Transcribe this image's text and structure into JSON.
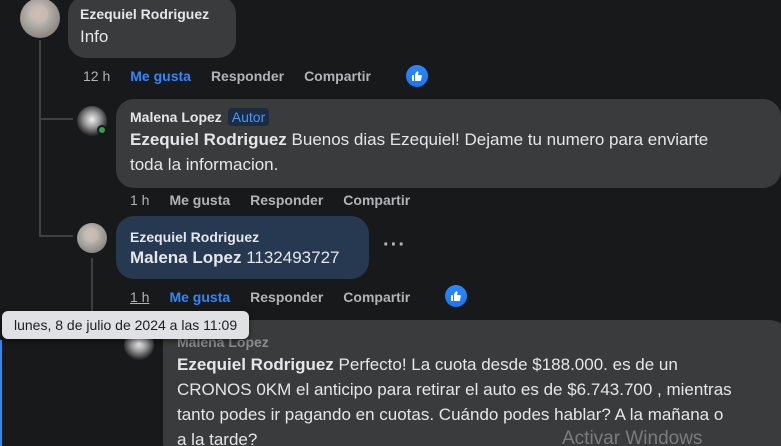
{
  "comment1": {
    "author": "Ezequiel Rodriguez",
    "text": "Info",
    "time": "12 h",
    "like_label": "Me gusta",
    "reply_label": "Responder",
    "share_label": "Compartir"
  },
  "reply1": {
    "author": "Malena Lopez",
    "badge": "Autor",
    "mention": "Ezequiel Rodriguez",
    "text_line1": " Buenos dias Ezequiel! Dejame tu numero para enviarte",
    "text_line2": "toda la informacion.",
    "time": "1 h",
    "like_label": "Me gusta",
    "reply_label": "Responder",
    "share_label": "Compartir"
  },
  "reply2": {
    "author": "Ezequiel Rodriguez",
    "mention": "Malena Lopez",
    "text": " 1132493727",
    "more_label": "···",
    "time": "1 h",
    "like_label": "Me gusta",
    "reply_label": "Responder",
    "share_label": "Compartir"
  },
  "reply3": {
    "author": "Malena Lopez",
    "mention": "Ezequiel Rodriguez",
    "text_line1": " Perfecto! La cuota desde $188.000. es de un",
    "text_line2": "CRONOS 0KM el anticipo para retirar el auto es de $6.743.700 , mientras",
    "text_line3": "tanto podes ir pagando en cuotas. Cuándo podes hablar? A la mañana o",
    "text_line4": "a la tarde?"
  },
  "tooltip": {
    "text": "lunes, 8 de julio de 2024 a las 11:09"
  },
  "watermark": {
    "text": "Activar Windows"
  },
  "colors": {
    "background": "#18191a",
    "bubble": "#3a3b3c",
    "highlight_bubble": "#263951",
    "link_blue": "#2d88ff",
    "muted": "#b0b3b8"
  }
}
